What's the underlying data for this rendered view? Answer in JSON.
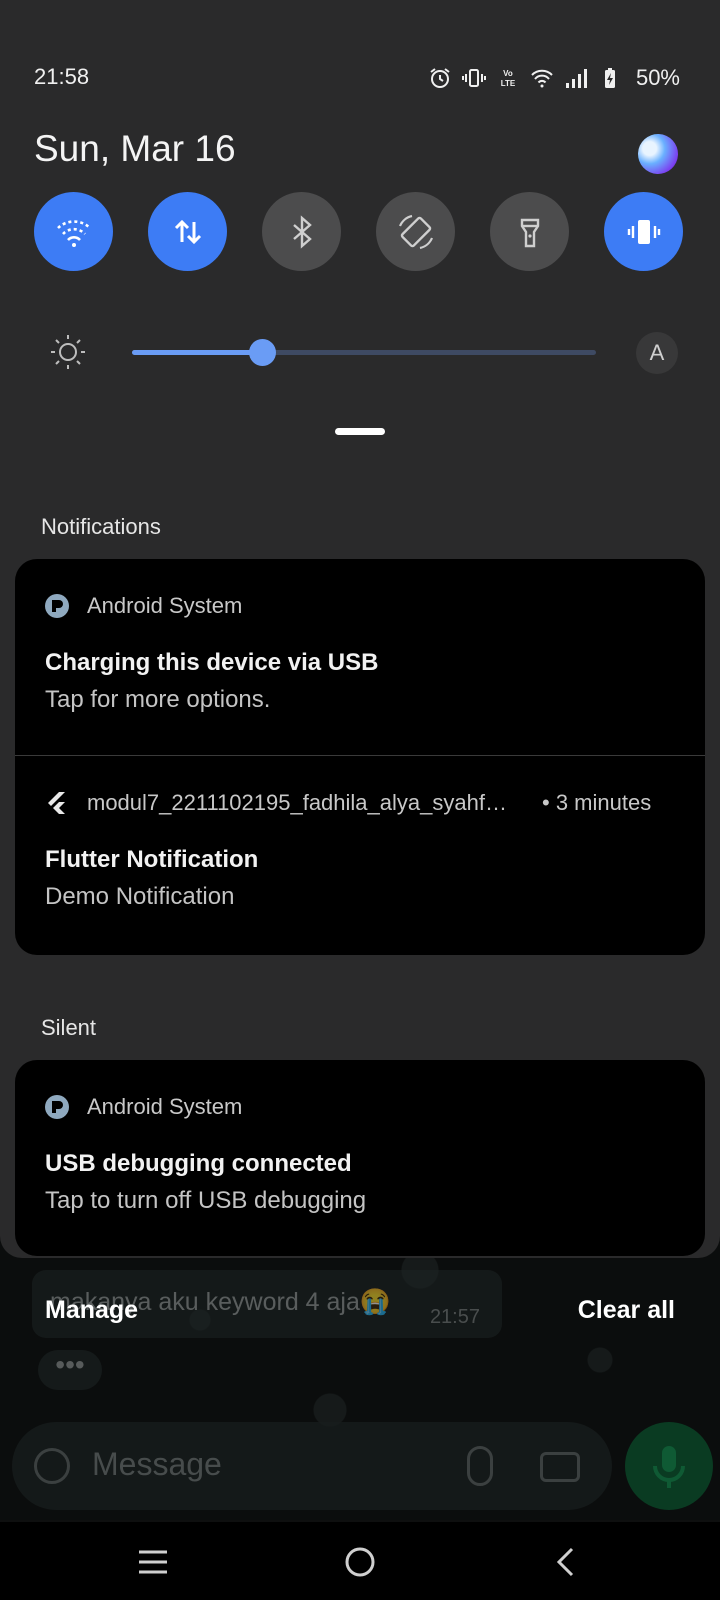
{
  "status_bar": {
    "time": "21:58",
    "battery": "50%"
  },
  "quick_settings": {
    "date": "Sun, Mar 16",
    "tiles": [
      {
        "name": "wifi",
        "state": "on"
      },
      {
        "name": "mobile-data",
        "state": "on"
      },
      {
        "name": "bluetooth",
        "state": "off"
      },
      {
        "name": "auto-rotate",
        "state": "off"
      },
      {
        "name": "flashlight",
        "state": "off"
      },
      {
        "name": "vibrate",
        "state": "on"
      }
    ],
    "brightness_level": 0.28,
    "auto_brightness_label": "A"
  },
  "notifications": {
    "section_label": "Notifications",
    "items": [
      {
        "app": "Android System",
        "title": "Charging this device via USB",
        "text": "Tap for more options."
      },
      {
        "app": "modul7_2211102195_fadhila_alya_syahf…",
        "time": "• 3 minutes",
        "title": "Flutter Notification",
        "text": "Demo Notification"
      }
    ]
  },
  "silent": {
    "section_label": "Silent",
    "items": [
      {
        "app": "Android System",
        "title": "USB debugging connected",
        "text": "Tap to turn off USB debugging"
      }
    ]
  },
  "actions": {
    "manage": "Manage",
    "clear_all": "Clear all"
  },
  "background_app": {
    "message_text": "makanya aku keyword 4 aja😭",
    "message_time": "21:57",
    "input_placeholder": "Message"
  },
  "colors": {
    "accent": "#3d7cf5",
    "panel": "#2a2a2b",
    "card": "#000000"
  }
}
